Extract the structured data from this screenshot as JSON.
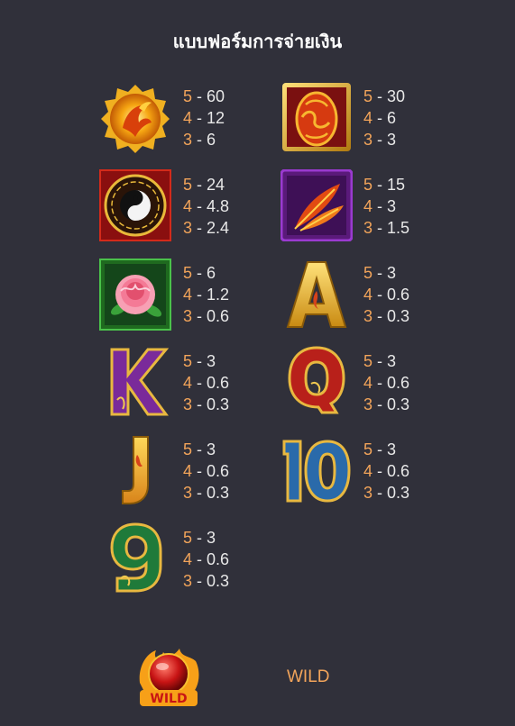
{
  "title": "แบบฟอร์มการจ่ายเงิน",
  "symbols": [
    {
      "icon": "phoenix-gold-icon",
      "pays": [
        {
          "n": "5",
          "v": "60"
        },
        {
          "n": "4",
          "v": "12"
        },
        {
          "n": "3",
          "v": "6"
        }
      ]
    },
    {
      "icon": "red-egg-icon",
      "pays": [
        {
          "n": "5",
          "v": "30"
        },
        {
          "n": "4",
          "v": "6"
        },
        {
          "n": "3",
          "v": "3"
        }
      ]
    },
    {
      "icon": "yin-yang-icon",
      "pays": [
        {
          "n": "5",
          "v": "24"
        },
        {
          "n": "4",
          "v": "4.8"
        },
        {
          "n": "3",
          "v": "2.4"
        }
      ]
    },
    {
      "icon": "feather-icon",
      "pays": [
        {
          "n": "5",
          "v": "15"
        },
        {
          "n": "4",
          "v": "3"
        },
        {
          "n": "3",
          "v": "1.5"
        }
      ]
    },
    {
      "icon": "peony-flower-icon",
      "pays": [
        {
          "n": "5",
          "v": "6"
        },
        {
          "n": "4",
          "v": "1.2"
        },
        {
          "n": "3",
          "v": "0.6"
        }
      ]
    },
    {
      "icon": "letter-a-icon",
      "pays": [
        {
          "n": "5",
          "v": "3"
        },
        {
          "n": "4",
          "v": "0.6"
        },
        {
          "n": "3",
          "v": "0.3"
        }
      ]
    },
    {
      "icon": "letter-k-icon",
      "pays": [
        {
          "n": "5",
          "v": "3"
        },
        {
          "n": "4",
          "v": "0.6"
        },
        {
          "n": "3",
          "v": "0.3"
        }
      ]
    },
    {
      "icon": "letter-q-icon",
      "pays": [
        {
          "n": "5",
          "v": "3"
        },
        {
          "n": "4",
          "v": "0.6"
        },
        {
          "n": "3",
          "v": "0.3"
        }
      ]
    },
    {
      "icon": "letter-j-icon",
      "pays": [
        {
          "n": "5",
          "v": "3"
        },
        {
          "n": "4",
          "v": "0.6"
        },
        {
          "n": "3",
          "v": "0.3"
        }
      ]
    },
    {
      "icon": "number-10-icon",
      "pays": [
        {
          "n": "5",
          "v": "3"
        },
        {
          "n": "4",
          "v": "0.6"
        },
        {
          "n": "3",
          "v": "0.3"
        }
      ]
    },
    {
      "icon": "number-9-icon",
      "pays": [
        {
          "n": "5",
          "v": "3"
        },
        {
          "n": "4",
          "v": "0.6"
        },
        {
          "n": "3",
          "v": "0.3"
        }
      ]
    }
  ],
  "wild": {
    "icon": "wild-orb-icon",
    "logo_text": "WILD",
    "label": "WILD"
  },
  "colors": {
    "background": "#30303a",
    "count": "#f2a45a",
    "value": "#e8e8e8",
    "title": "#ffffff"
  }
}
